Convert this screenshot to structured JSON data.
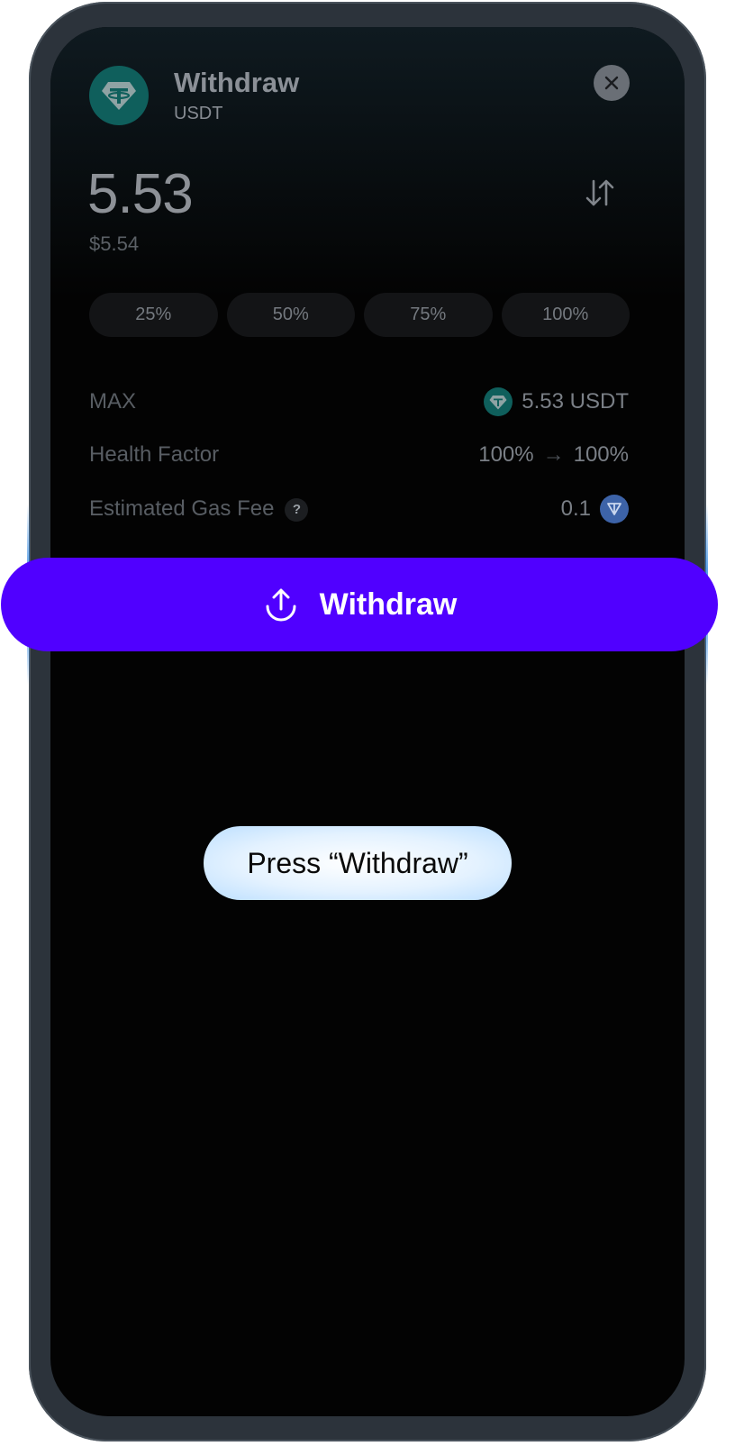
{
  "header": {
    "title": "Withdraw",
    "asset": "USDT",
    "coin_icon": "tether-icon",
    "close_icon": "close-icon"
  },
  "amount": {
    "value": "5.53",
    "fiat_value": "$5.54",
    "swap_icon": "swap-vertical-icon"
  },
  "percent_buttons": [
    "25%",
    "50%",
    "75%",
    "100%"
  ],
  "details": {
    "max": {
      "label": "MAX",
      "value": "5.53 USDT",
      "icon": "tether-icon"
    },
    "health_factor": {
      "label": "Health Factor",
      "from": "100%",
      "arrow": "→",
      "to": "100%"
    },
    "gas_fee": {
      "label": "Estimated Gas Fee",
      "help": "?",
      "value": "0.1",
      "icon": "ton-icon"
    }
  },
  "action": {
    "label": "Withdraw",
    "icon": "upload-icon"
  },
  "hint": {
    "text": "Press “Withdraw”"
  },
  "colors": {
    "accent": "#5000ff",
    "tether": "#0f5f5c",
    "ton": "#3d63a8",
    "background": "#030303"
  }
}
